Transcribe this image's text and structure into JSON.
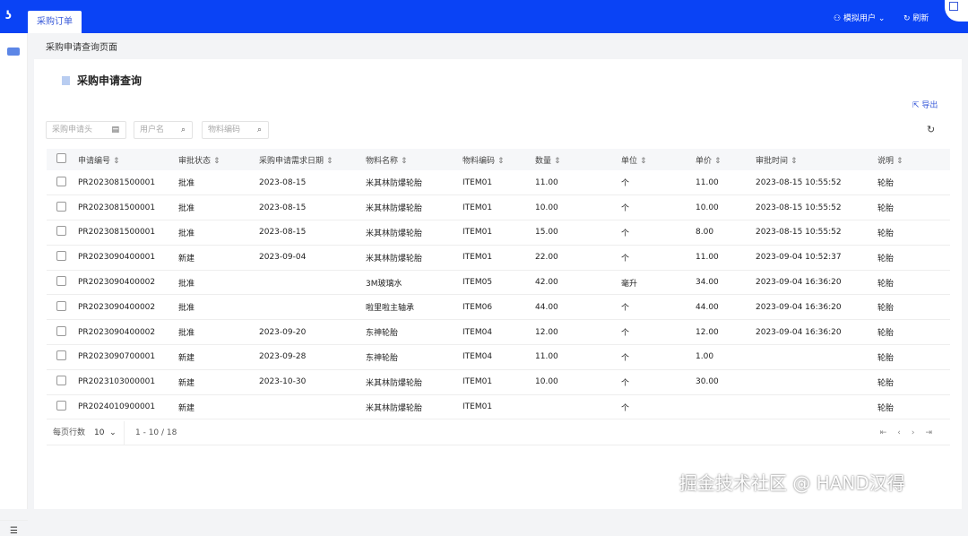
{
  "header": {
    "tab": "采购订单",
    "user": "模拟用户",
    "refresh": "刷新"
  },
  "breadcrumb": "采购申请查询页面",
  "page": {
    "title": "采购申请查询",
    "export": "导出"
  },
  "filters": [
    {
      "placeholder": "采购申请头"
    },
    {
      "placeholder": "用户名"
    },
    {
      "placeholder": "物料编码"
    }
  ],
  "table": {
    "columns": [
      "申请编号",
      "审批状态",
      "采购申请需求日期",
      "物料名称",
      "物料编码",
      "数量",
      "单位",
      "单价",
      "审批时间",
      "说明"
    ],
    "rows": [
      [
        "PR2023081500001",
        "批准",
        "2023-08-15",
        "米其林防爆轮胎",
        "ITEM01",
        "11.00",
        "个",
        "11.00",
        "2023-08-15 10:55:52",
        "轮胎"
      ],
      [
        "PR2023081500001",
        "批准",
        "2023-08-15",
        "米其林防爆轮胎",
        "ITEM01",
        "10.00",
        "个",
        "10.00",
        "2023-08-15 10:55:52",
        "轮胎"
      ],
      [
        "PR2023081500001",
        "批准",
        "2023-08-15",
        "米其林防爆轮胎",
        "ITEM01",
        "15.00",
        "个",
        "8.00",
        "2023-08-15 10:55:52",
        "轮胎"
      ],
      [
        "PR2023090400001",
        "新建",
        "2023-09-04",
        "米其林防爆轮胎",
        "ITEM01",
        "22.00",
        "个",
        "11.00",
        "2023-09-04 10:52:37",
        "轮胎"
      ],
      [
        "PR2023090400002",
        "批准",
        "",
        "3M玻璃水",
        "ITEM05",
        "42.00",
        "毫升",
        "34.00",
        "2023-09-04 16:36:20",
        "轮胎"
      ],
      [
        "PR2023090400002",
        "批准",
        "",
        "啦里啦主轴承",
        "ITEM06",
        "44.00",
        "个",
        "44.00",
        "2023-09-04 16:36:20",
        "轮胎"
      ],
      [
        "PR2023090400002",
        "批准",
        "2023-09-20",
        "东神轮胎",
        "ITEM04",
        "12.00",
        "个",
        "12.00",
        "2023-09-04 16:36:20",
        "轮胎"
      ],
      [
        "PR2023090700001",
        "新建",
        "2023-09-28",
        "东神轮胎",
        "ITEM04",
        "11.00",
        "个",
        "1.00",
        "",
        "轮胎"
      ],
      [
        "PR2023103000001",
        "新建",
        "2023-10-30",
        "米其林防爆轮胎",
        "ITEM01",
        "10.00",
        "个",
        "30.00",
        "",
        "轮胎"
      ],
      [
        "PR2024010900001",
        "新建",
        "",
        "米其林防爆轮胎",
        "ITEM01",
        "",
        "个",
        "",
        "",
        "轮胎"
      ]
    ]
  },
  "pagination": {
    "rows_label": "每页行数",
    "page_size": "10",
    "range": "1 - 10 / 18"
  },
  "watermark": "掘金技术社区 @ HAND汉得"
}
